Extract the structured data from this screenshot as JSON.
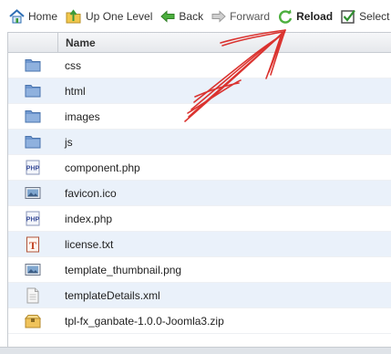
{
  "toolbar": {
    "home_label": "Home",
    "up_label": "Up One Level",
    "back_label": "Back",
    "forward_label": "Forward",
    "reload_label": "Reload",
    "select_all_label": "Select All"
  },
  "table": {
    "header_name": "Name",
    "rows": [
      {
        "name": "css",
        "icon": "folder-icon"
      },
      {
        "name": "html",
        "icon": "folder-icon"
      },
      {
        "name": "images",
        "icon": "folder-icon"
      },
      {
        "name": "js",
        "icon": "folder-icon"
      },
      {
        "name": "component.php",
        "icon": "php-file-icon"
      },
      {
        "name": "favicon.ico",
        "icon": "image-file-icon"
      },
      {
        "name": "index.php",
        "icon": "php-file-icon"
      },
      {
        "name": "license.txt",
        "icon": "text-file-icon"
      },
      {
        "name": "template_thumbnail.png",
        "icon": "image-file-icon"
      },
      {
        "name": "templateDetails.xml",
        "icon": "xml-file-icon"
      },
      {
        "name": "tpl-fx_ganbate-1.0.0-Joomla3.zip",
        "icon": "zip-file-icon"
      }
    ]
  },
  "colors": {
    "row_alt": "#eaf1fa",
    "folder": "#5b86bf",
    "annotation_red": "#d9231f"
  }
}
